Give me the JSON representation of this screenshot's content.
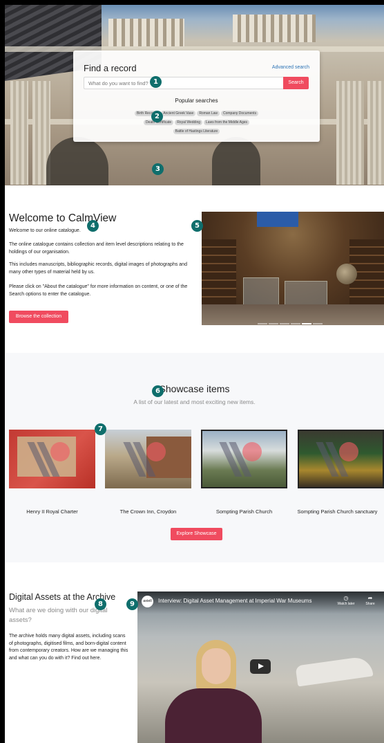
{
  "hero": {
    "search": {
      "title": "Find a record",
      "advanced_link": "Advanced search",
      "placeholder": "What do you want to find?",
      "button": "Search",
      "popular_title": "Popular searches",
      "popular": [
        "Birth Records",
        "Ancient Greek Vase",
        "Roman Law",
        "Company Documents",
        "Death Certificate",
        "Royal Wedding",
        "Laws from the Middle Ages",
        "Battle of Hastings Literature"
      ]
    }
  },
  "welcome": {
    "title": "Welcome to CalmView",
    "intro": "Welcome to our online catalogue.",
    "paragraphs": [
      "The online catalogue contains collection and item level descriptions relating to the holdings of our organisation.",
      "This includes manuscripts, bibliographic records, digital images of photographs and many other types of material held by us.",
      "Please click on \"About the catalogue\" for more information on content, or one of the Search options to enter the catalogue."
    ],
    "button": "Browse the collection",
    "carousel": {
      "slides": 6,
      "active": 4
    }
  },
  "showcase": {
    "title": "Showcase items",
    "subtitle": "A list of our latest and most exciting new items.",
    "items": [
      {
        "caption": "Henry II Royal Charter",
        "icon": "charter-image"
      },
      {
        "caption": "The Crown Inn, Croydon",
        "icon": "street-image"
      },
      {
        "caption": "Sompting Parish Church",
        "icon": "church-image"
      },
      {
        "caption": "Sompting Parish Church sanctuary",
        "icon": "sanctuary-image"
      }
    ],
    "button": "Explore Showcase"
  },
  "digital": {
    "title": "Digital Assets at the Archive",
    "subtitle": "What are we doing with our digital assets?",
    "body": "The archive holds many digital assets, including scans of photographs, digitised films, and born-digital content from contemporary creators. How are we managing this and what can you do with it? Find out here.",
    "video": {
      "channel": "axiell",
      "title": "Interview: Digital Asset Management at Imperial War Museums",
      "watch_later": "Watch later",
      "share": "Share"
    }
  },
  "markers": [
    "1",
    "2",
    "3",
    "4",
    "5",
    "6",
    "7",
    "8",
    "9"
  ],
  "colors": {
    "accent": "#f04b5f",
    "link": "#2a72b5",
    "marker": "#0f6e6c"
  }
}
